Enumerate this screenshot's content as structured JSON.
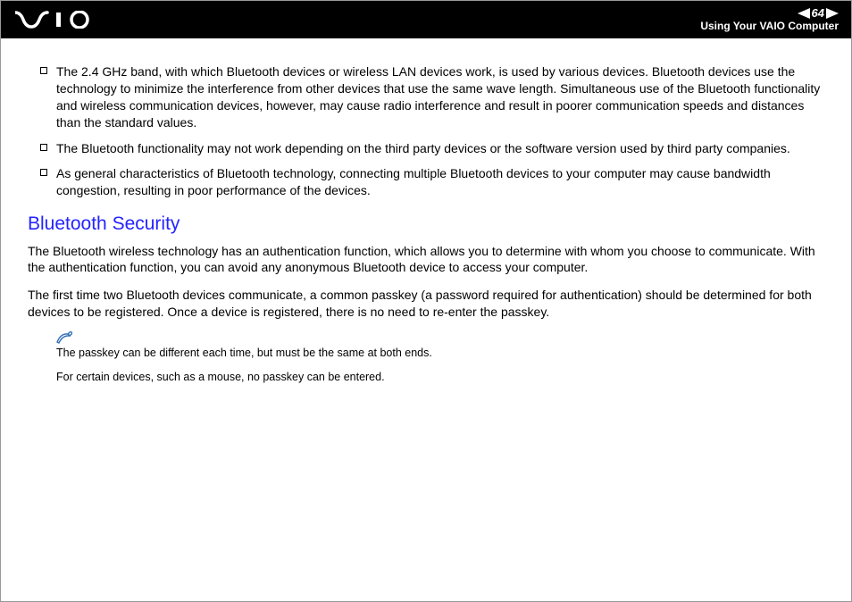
{
  "header": {
    "page_number": "64",
    "section_title": "Using Your VAIO Computer"
  },
  "bullets": [
    "The 2.4 GHz band, with which Bluetooth devices or wireless LAN devices work, is used by various devices. Bluetooth devices use the technology to minimize the interference from other devices that use the same wave length. Simultaneous use of the Bluetooth functionality and wireless communication devices, however, may cause radio interference and result in poorer communication speeds and distances than the standard values.",
    "The Bluetooth functionality may not work depending on the third party devices or the software version used by third party companies.",
    "As general characteristics of Bluetooth technology, connecting multiple Bluetooth devices to your computer may cause bandwidth congestion, resulting in poor performance of the devices."
  ],
  "section": {
    "heading": "Bluetooth Security",
    "p1": "The Bluetooth wireless technology has an authentication function, which allows you to determine with whom you choose to communicate. With the authentication function, you can avoid any anonymous Bluetooth device to access your computer.",
    "p2": "The first time two Bluetooth devices communicate, a common passkey (a password required for authentication) should be determined for both devices to be registered. Once a device is registered, there is no need to re-enter the passkey."
  },
  "notes": {
    "n1": "The passkey can be different each time, but must be the same at both ends.",
    "n2": "For certain devices, such as a mouse, no passkey can be entered."
  }
}
